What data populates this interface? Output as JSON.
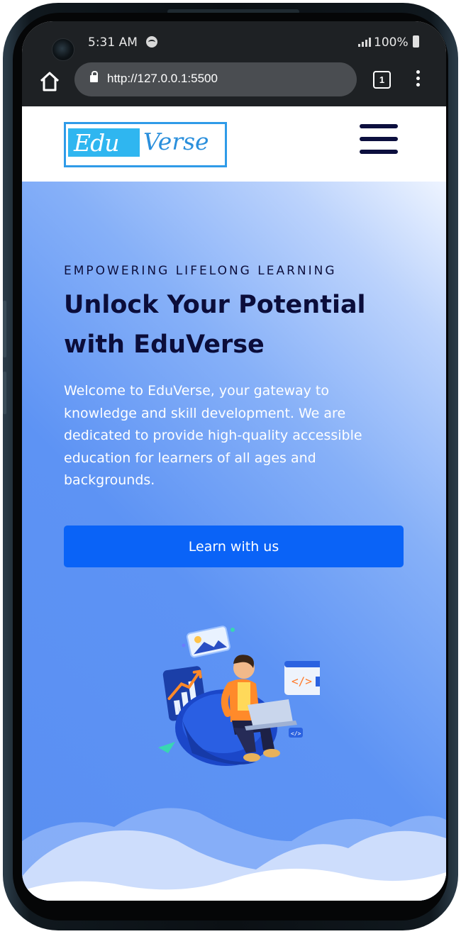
{
  "status_bar": {
    "time": "5:31 AM",
    "battery": "100%"
  },
  "browser": {
    "url": "http://127.0.0.1:5500",
    "tab_count": "1"
  },
  "site": {
    "logo_part_1": "Edu",
    "logo_part_2": "Verse"
  },
  "hero": {
    "eyebrow": "EMPOWERING LIFELONG LEARNING",
    "headline": "Unlock Your Potential with EduVerse",
    "intro": "Welcome to EduVerse, your gateway to knowledge and skill development. We are dedicated to provide high-quality accessible education for learners of all ages and backgrounds.",
    "cta_label": "Learn with us"
  },
  "colors": {
    "navy": "#0b0d3a",
    "cta": "#0a63f7",
    "logo_blue": "#2fb6f0"
  },
  "icons": [
    "home-icon",
    "lock-icon",
    "tab-switcher-icon",
    "more-vert-icon",
    "hamburger-menu-icon",
    "spotify-icon",
    "signal-icon",
    "battery-icon"
  ]
}
